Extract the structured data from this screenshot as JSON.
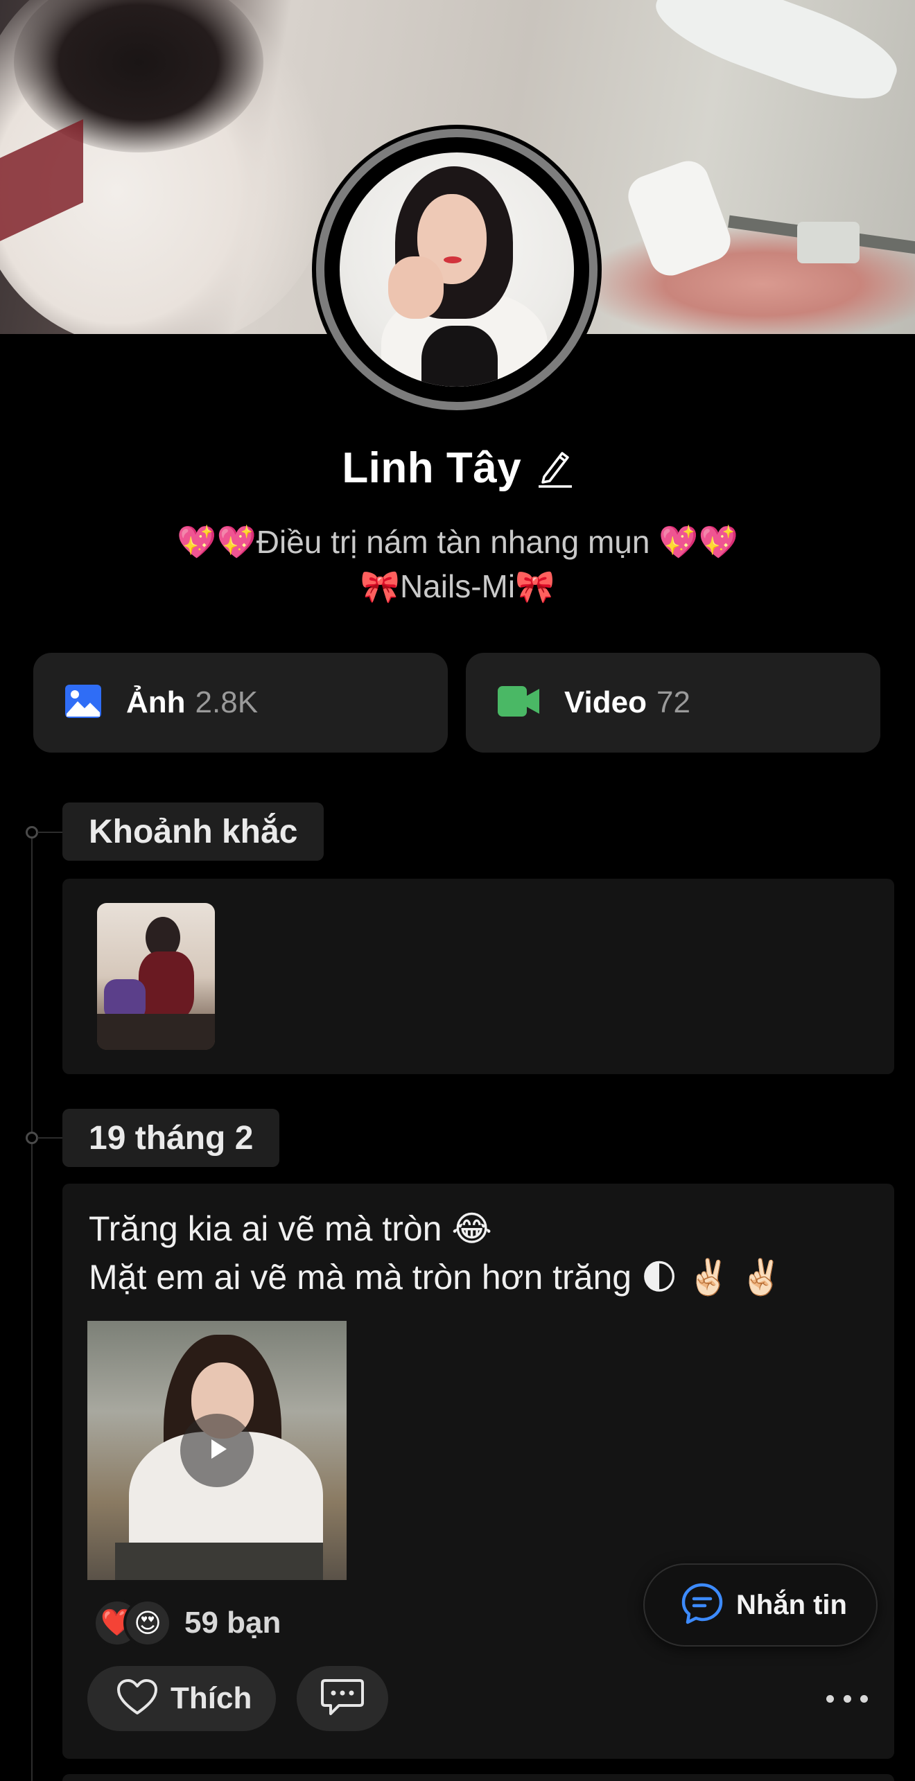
{
  "profile": {
    "name": "Linh Tây",
    "bio_line1": "💖💖Điều trị nám tàn nhang mụn 💖💖",
    "bio_line2": "🎀Nails-Mi🎀"
  },
  "media": {
    "photos": {
      "label": "Ảnh",
      "count": "2.8K",
      "icon": "image-icon",
      "icon_color": "#2f6df6"
    },
    "videos": {
      "label": "Video",
      "count": "72",
      "icon": "video-camera-icon",
      "icon_color": "#4ab865"
    }
  },
  "timeline": {
    "moments_label": "Khoảnh khắc",
    "post": {
      "date": "19 tháng 2",
      "text_line1": "Trăng kia ai vẽ mà tròn 😂",
      "text_line2": "Mặt em ai vẽ mà mà tròn hơn trăng 🌓 ✌🏻 ✌🏻",
      "reactions": [
        "❤️",
        "😍"
      ],
      "reaction_count": "59 bạn",
      "like_label": "Thích"
    }
  },
  "floating": {
    "message_label": "Nhắn tin",
    "accent": "#3d8bff"
  },
  "colors": {
    "background": "#000000",
    "card": "#141414",
    "button": "#1f1f1f"
  }
}
